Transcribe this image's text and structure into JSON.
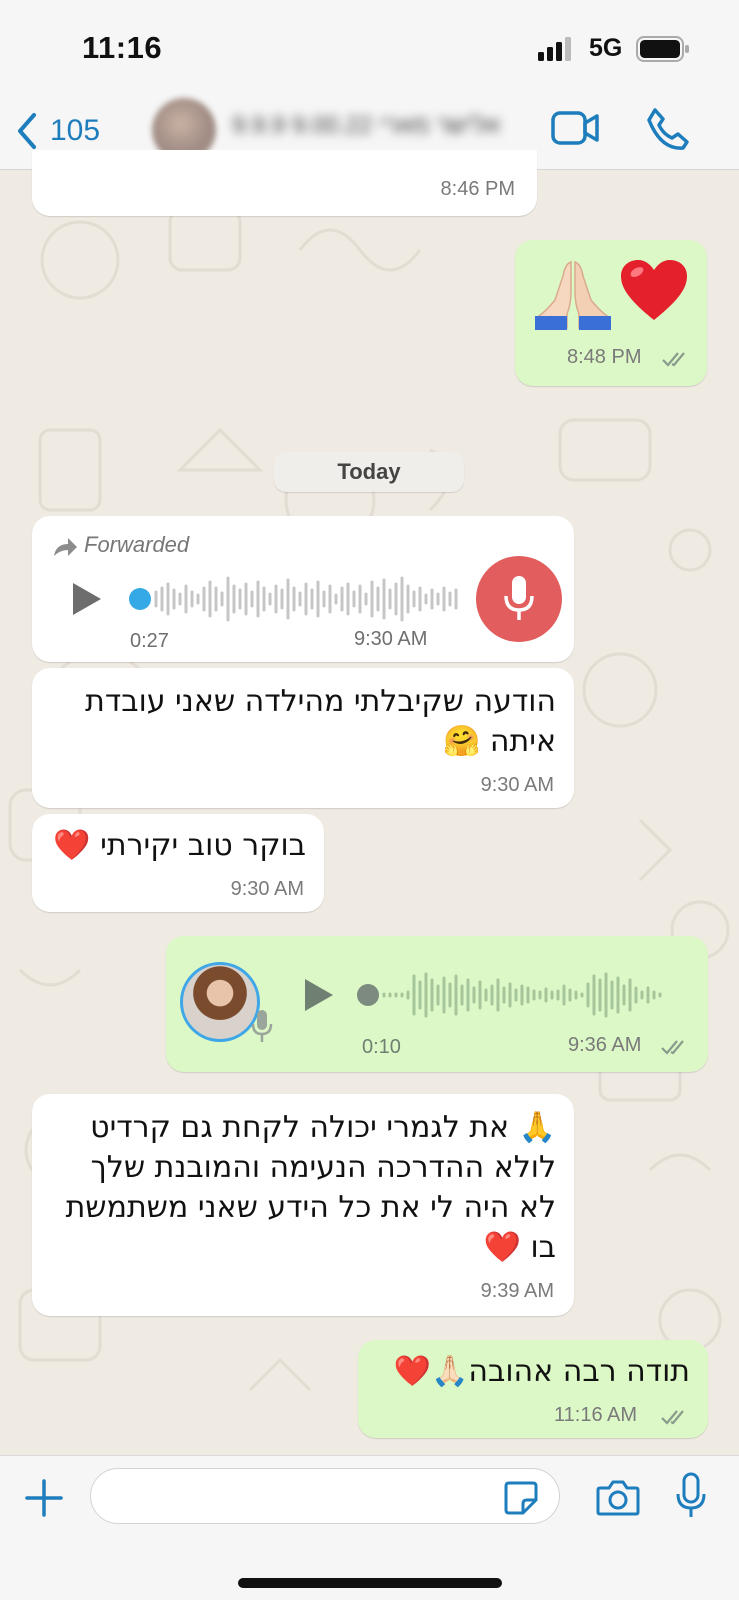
{
  "status_bar": {
    "time": "11:16",
    "network": "5G"
  },
  "header": {
    "back_count": "105",
    "contact_name": "‏אלישר מארי 9.00.22 9.9.9"
  },
  "day_chip": "Today",
  "messages": {
    "partial_in": {
      "time": "8:46 PM"
    },
    "out_emojis": {
      "text": "🙏🏻 ❤️",
      "time": "8:48 PM"
    },
    "forwarded_voice": {
      "forwarded_label": "Forwarded",
      "duration": "0:27",
      "time": "9:30 AM"
    },
    "text_1": {
      "text": "הודעה שקיבלתי מהילדה שאני עובדת איתה 🤗",
      "time": "9:30 AM"
    },
    "text_2": {
      "text": "בוקר טוב יקירתי ❤️",
      "time": "9:30 AM"
    },
    "out_voice": {
      "duration": "0:10",
      "time": "9:36 AM"
    },
    "text_3": {
      "text": "🙏 את לגמרי יכולה לקחת גם קרדיט לולא ההדרכה הנעימה והמובנת שלך לא היה לי את כל הידע שאני משתמשת בו ❤️",
      "time": "9:39 AM"
    },
    "out_text": {
      "text": "תודה רבה אהובה🙏🏻❤️",
      "time": "11:16 AM"
    }
  },
  "input": {
    "placeholder": ""
  },
  "colors": {
    "accent": "#1e7dbc",
    "incoming_bubble": "#ffffff",
    "outgoing_bubble": "#dcf8c6",
    "mic_button": "#e25d5d",
    "timestamp": "#7a7a7a"
  },
  "icons": [
    "back-chevron-icon",
    "video-call-icon",
    "phone-icon",
    "forward-arrow-icon",
    "play-icon",
    "microphone-icon",
    "read-ticks-icon",
    "plus-icon",
    "sticker-icon",
    "camera-icon",
    "mic-icon"
  ]
}
